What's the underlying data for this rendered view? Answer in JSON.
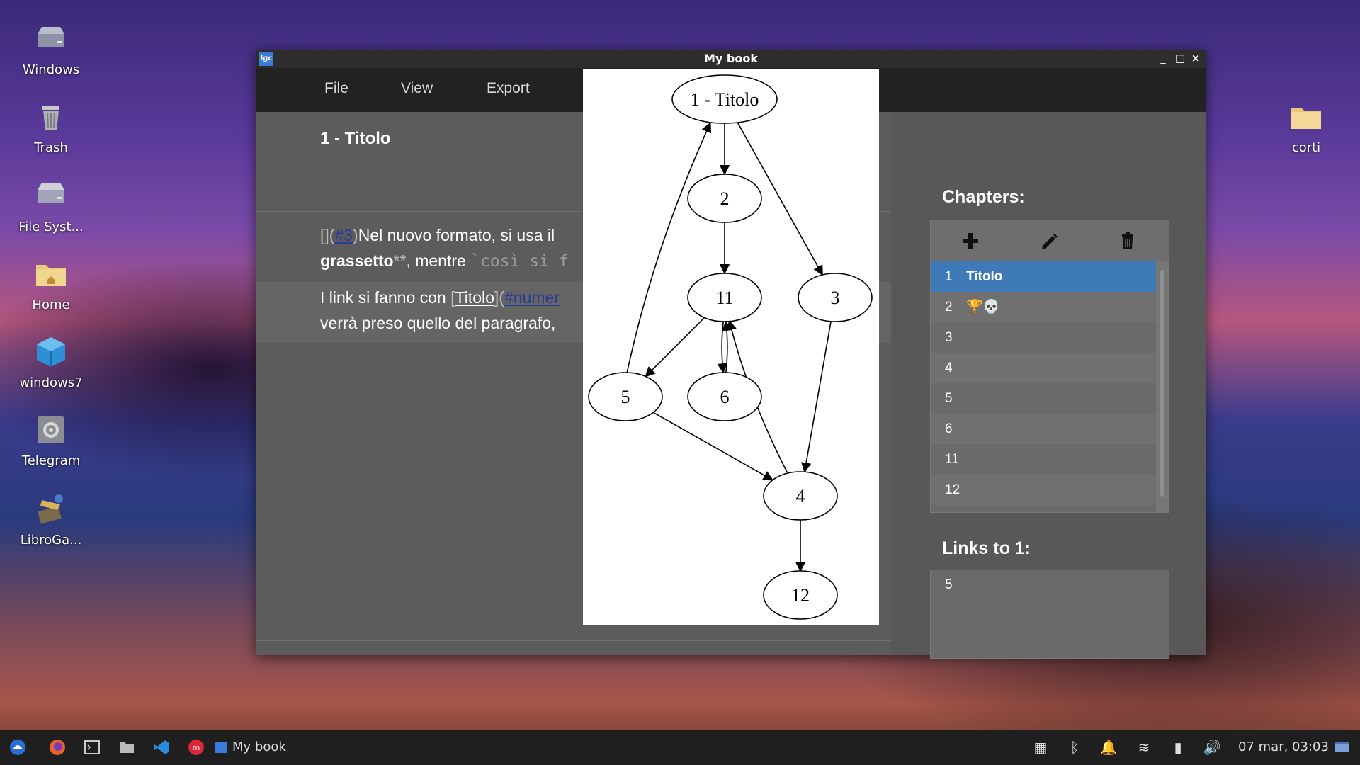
{
  "desktop": {
    "icons": [
      {
        "label": "Windows",
        "icon": "drive-icon"
      },
      {
        "label": "Trash",
        "icon": "trash-icon"
      },
      {
        "label": "File Syst...",
        "icon": "harddisk-icon"
      },
      {
        "label": "Home",
        "icon": "home-folder-icon"
      },
      {
        "label": "windows7",
        "icon": "virtualbox-icon"
      },
      {
        "label": "Telegram",
        "icon": "settings-app-icon"
      },
      {
        "label": "LibroGa...",
        "icon": "app-icon"
      },
      {
        "label": "corti",
        "icon": "folder-icon"
      }
    ]
  },
  "window": {
    "title": "My book",
    "app_icon_text": "lgc",
    "controls": [
      "_",
      "□",
      "×"
    ]
  },
  "menu": [
    "File",
    "View",
    "Export"
  ],
  "editor": {
    "chapter_title": "1 - Titolo",
    "para1_line1_prefix": "[](",
    "para1_line1_link": "#3",
    "para1_line1_suffix": ")",
    "para1_line1_text": "Nel nuovo formato, si usa il",
    "para1_line2_bold": "grassetto",
    "para1_line2_stars": "**",
    "para1_line2_text": ", mentre ",
    "para1_line2_code": "`così si f",
    "para2_line1_text": "I link si fanno con ",
    "para2_line1_link1_open": "[",
    "para2_line1_link1": "Titolo",
    "para2_line1_link1_close": "](",
    "para2_line1_link2": "#numer",
    "para2_line2_text": "verrà preso quello del paragrafo,"
  },
  "graph": {
    "nodes": [
      "1 - Titolo",
      "2",
      "11",
      "3",
      "5",
      "6",
      "4",
      "12"
    ],
    "edges": [
      [
        "1 - Titolo",
        "2"
      ],
      [
        "1 - Titolo",
        "3"
      ],
      [
        "2",
        "11"
      ],
      [
        "11",
        "5"
      ],
      [
        "11",
        "6"
      ],
      [
        "6",
        "11"
      ],
      [
        "5",
        "1 - Titolo"
      ],
      [
        "5",
        "4"
      ],
      [
        "3",
        "4"
      ],
      [
        "4",
        "11"
      ],
      [
        "4",
        "12"
      ]
    ]
  },
  "chapters": {
    "heading": "Chapters:",
    "tools": [
      "add-icon",
      "edit-pencil-icon",
      "delete-trash-icon"
    ],
    "rows": [
      {
        "num": "1",
        "name": "Titolo",
        "selected": true
      },
      {
        "num": "2",
        "name": "",
        "emoji": "🏆💀"
      },
      {
        "num": "3",
        "name": ""
      },
      {
        "num": "4",
        "name": ""
      },
      {
        "num": "5",
        "name": ""
      },
      {
        "num": "6",
        "name": ""
      },
      {
        "num": "11",
        "name": ""
      },
      {
        "num": "12",
        "name": ""
      }
    ]
  },
  "links": {
    "heading": "Links to 1:",
    "items": [
      "5"
    ]
  },
  "taskbar": {
    "active_app": "My book",
    "clock": "07 mar, 03:03"
  },
  "colors": {
    "selection": "#3e7ab8",
    "link": "#2a3a9a"
  }
}
